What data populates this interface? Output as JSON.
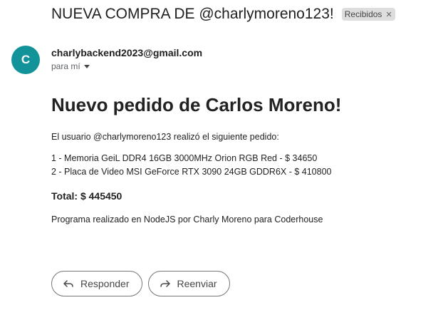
{
  "email": {
    "subject": "NUEVA COMPRA DE @charlymoreno123!",
    "label": "Recibidos",
    "label_remove_icon": "close-icon",
    "sender_initial": "C",
    "avatar_color": "#12939a",
    "sender_email": "charlybackend2023@gmail.com",
    "recipient_text": "para mí",
    "recipient_icon": "caret-down-icon"
  },
  "message": {
    "heading": "Nuevo pedido de Carlos Moreno!",
    "intro": "El usuario @charlymoreno123 realizó el siguiente pedido:",
    "items": [
      "1 - Memoria GeiL DDR4 16GB 3000MHz Orion RGB Red - $ 34650",
      "2 - Placa de Video MSI GeForce RTX 3090 24GB GDDR6X - $ 410800"
    ],
    "total": "Total: $ 445450",
    "footer": "Programa realizado en NodeJS por Charly Moreno para Coderhouse"
  },
  "actions": {
    "reply_label": "Responder",
    "reply_icon": "reply-icon",
    "forward_label": "Reenviar",
    "forward_icon": "forward-icon"
  }
}
